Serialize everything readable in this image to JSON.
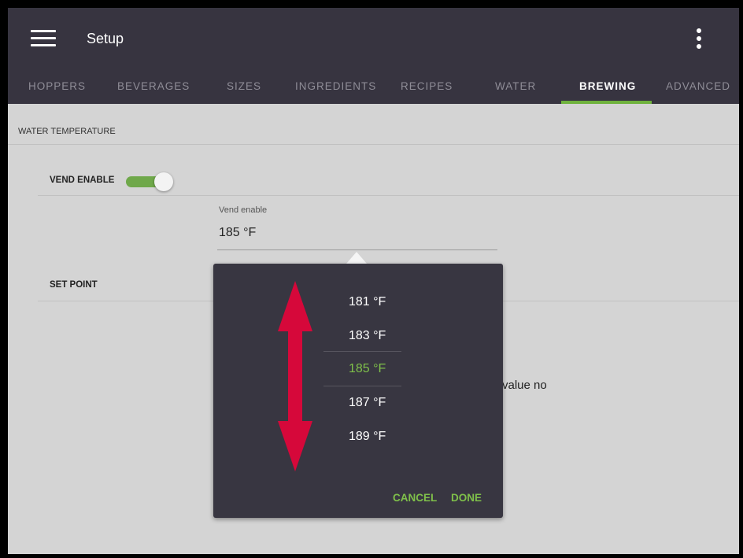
{
  "app": {
    "title": "Setup"
  },
  "tabs": [
    {
      "label": "HOPPERS",
      "active": false
    },
    {
      "label": "BEVERAGES",
      "active": false
    },
    {
      "label": "SIZES",
      "active": false
    },
    {
      "label": "INGREDIENTS",
      "active": false
    },
    {
      "label": "RECIPES",
      "active": false
    },
    {
      "label": "WATER",
      "active": false
    },
    {
      "label": "BREWING",
      "active": true
    },
    {
      "label": "ADVANCED",
      "active": false
    }
  ],
  "section": {
    "title": "WATER TEMPERATURE"
  },
  "vend_enable": {
    "label": "VEND ENABLE",
    "toggled_on": true
  },
  "field": {
    "label": "Vend enable",
    "value": "185 °F"
  },
  "set_point": {
    "label": "SET POINT"
  },
  "background_text": "value no",
  "picker": {
    "options": [
      "181 °F",
      "183 °F",
      "185 °F",
      "187 °F",
      "189 °F"
    ],
    "selected": "185 °F",
    "cancel_label": "CANCEL",
    "done_label": "DONE"
  },
  "colors": {
    "appbar": "#373440",
    "accent_green": "#6fb23d",
    "picker_bg": "#383641",
    "annotation_arrow": "#d6083a"
  },
  "icons": {
    "menu": "hamburger-menu-icon",
    "overflow": "vertical-dots-icon",
    "annotation": "double-headed-arrow"
  }
}
